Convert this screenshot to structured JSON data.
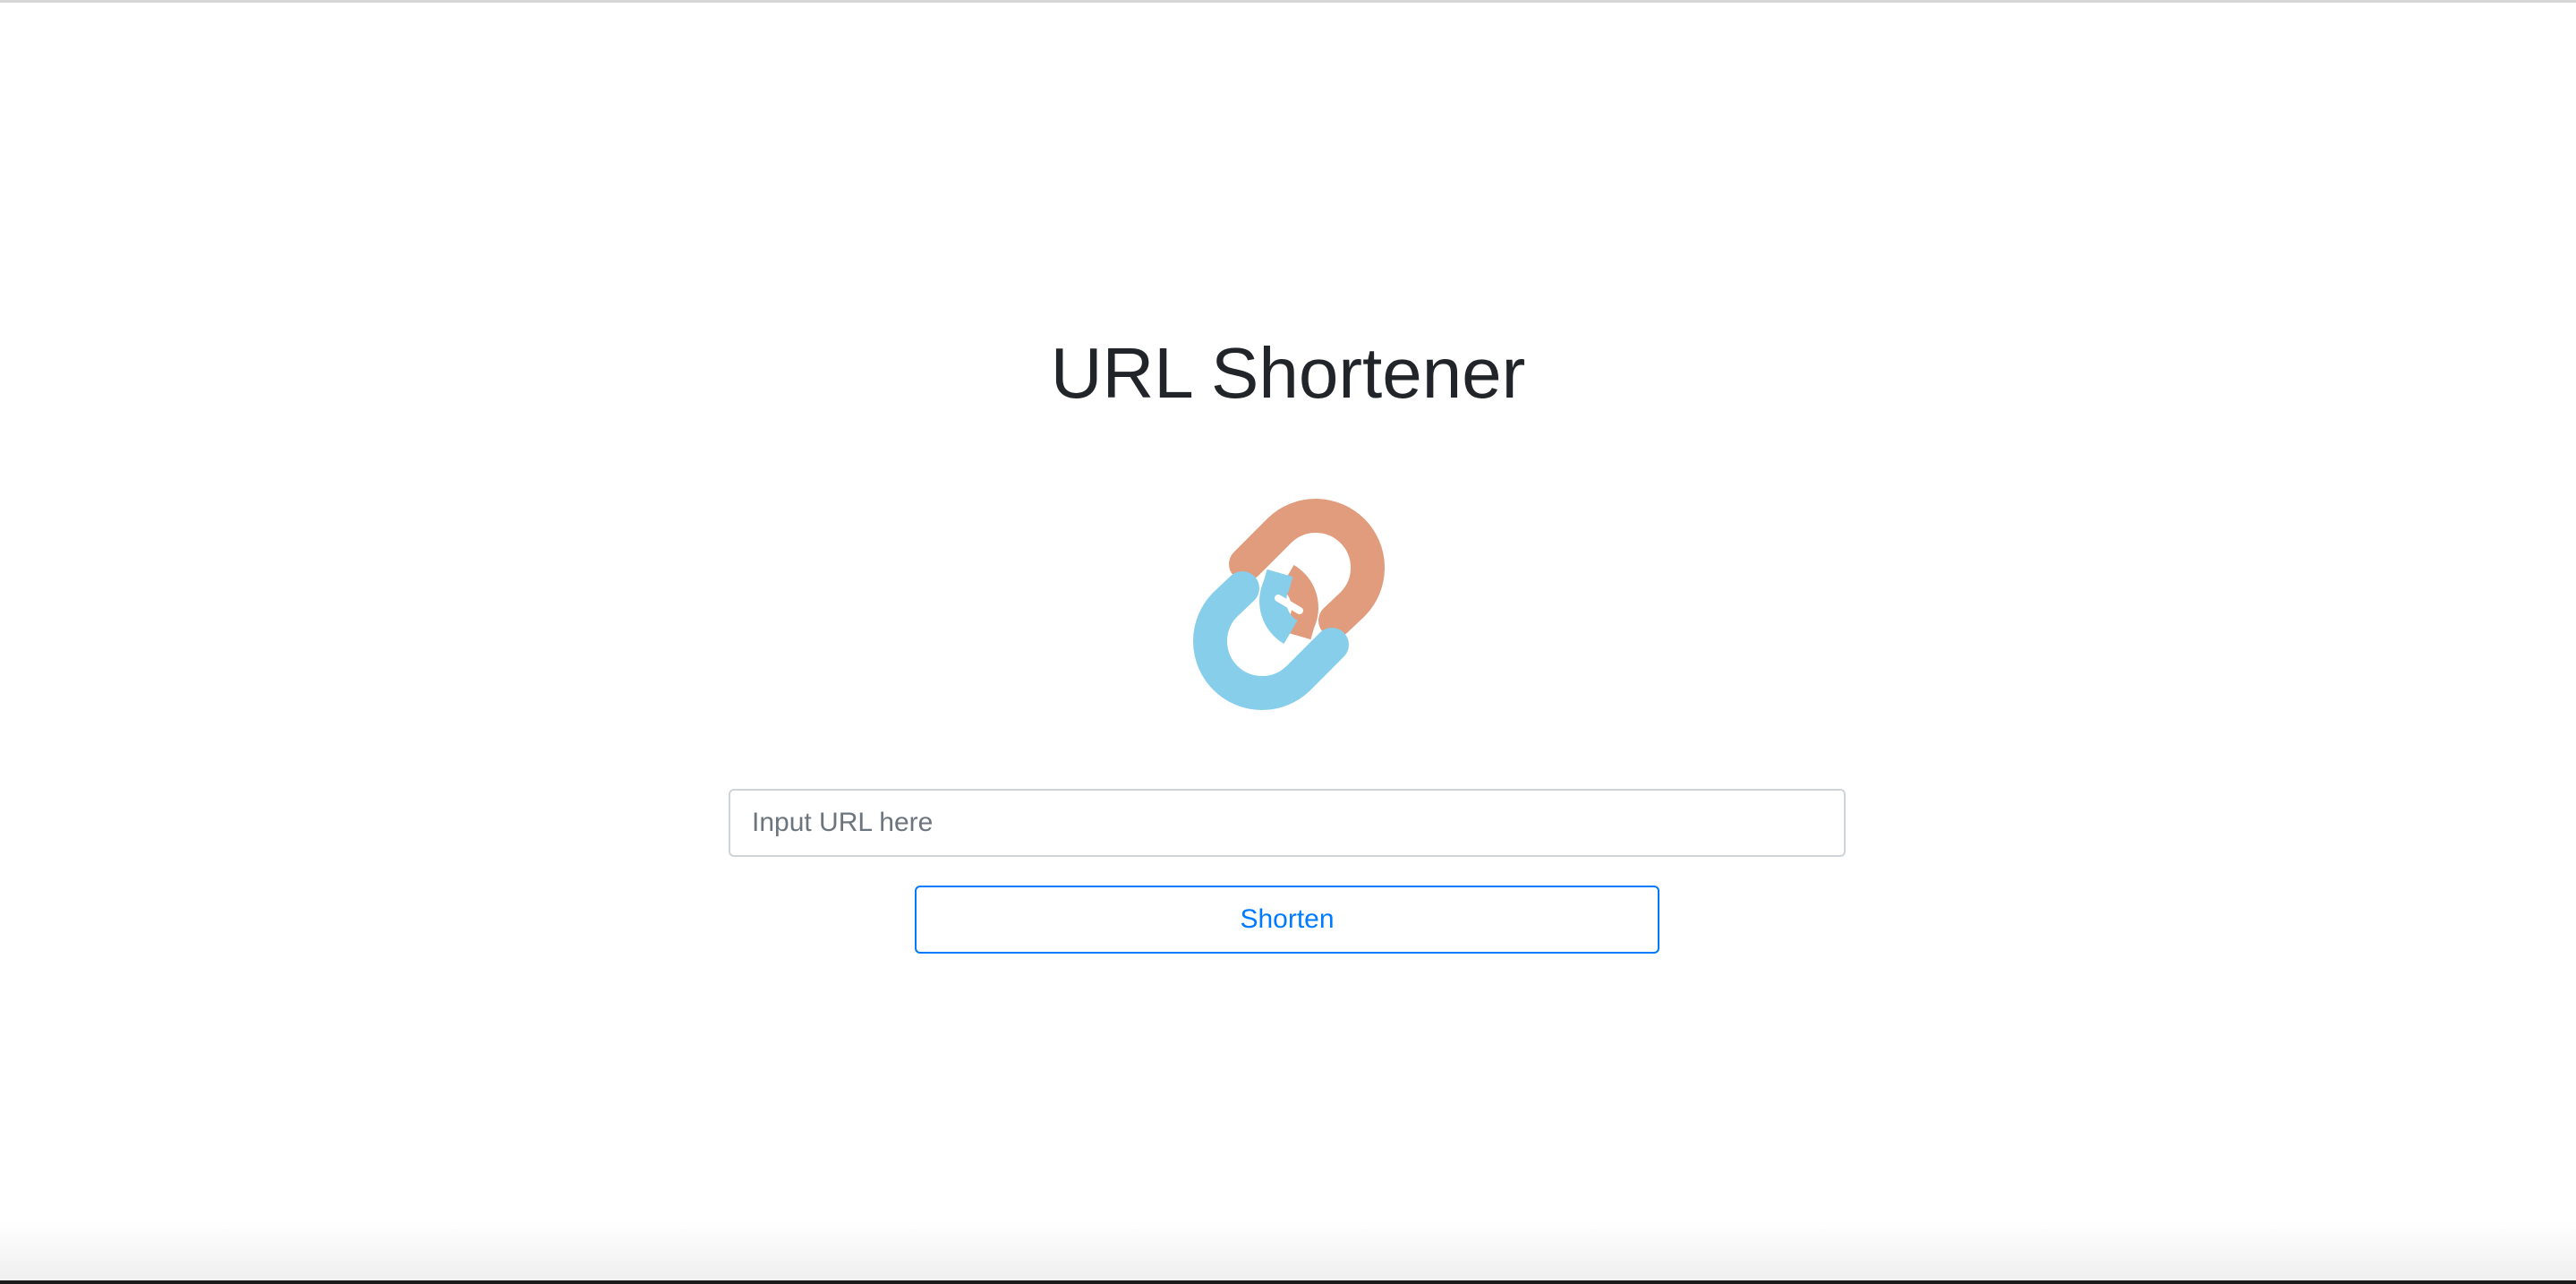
{
  "app": {
    "title": "URL Shortener"
  },
  "logo": {
    "icon": "chain-link-icon",
    "colors": {
      "blue": "#87CEEB",
      "orange": "#E09C7C"
    }
  },
  "form": {
    "url_input": {
      "value": "",
      "placeholder": "Input URL here"
    },
    "shorten_label": "Shorten"
  },
  "theme": {
    "accent": "#007bff",
    "text": "#212529",
    "border": "#ced4da"
  }
}
